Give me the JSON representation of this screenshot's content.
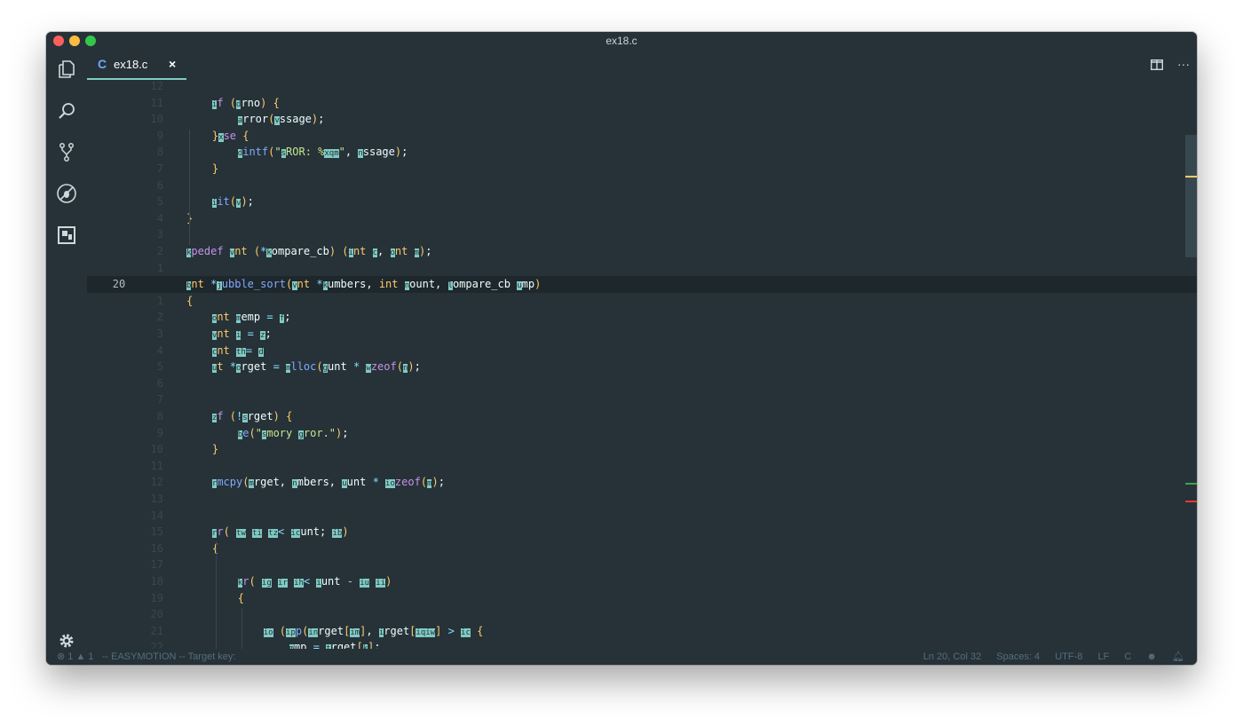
{
  "window": {
    "title": "ex18.c"
  },
  "tab": {
    "lang_icon": "C",
    "name": "ex18.c",
    "close": "×"
  },
  "tab_actions": {
    "split": "split-editor-icon",
    "more": "···"
  },
  "activity": [
    "files-icon",
    "search-icon",
    "source-control-icon",
    "debug-icon",
    "extensions-icon"
  ],
  "settings_icon": "gear-icon",
  "editor": {
    "current_line": 20,
    "lines": [
      {
        "n": "12",
        "html": ""
      },
      {
        "n": "11",
        "html": "    <span class='ej'>i</span><span class='tok-kw'>f</span> <span class='tok-br'>(</span><span class='ej'>d</span>rno<span class='tok-br'>)</span> <span class='tok-br'>{</span>"
      },
      {
        "n": "10",
        "html": "        <span class='ej'>a</span>rror<span class='tok-br'>(</span><span class='ej'>v</span>ssage<span class='tok-br'>)</span>;"
      },
      {
        "n": "9",
        "html": "    <span class='tok-br'>}</span><span class='ej'>x</span><span class='tok-kw'>se</span> <span class='tok-br'>{</span>"
      },
      {
        "n": "8",
        "html": "        <span class='ej'>d</span><span class='tok-fn'>intf</span><span class='tok-br'>(</span><span class='tok-str'>\"</span><span class='ej'>s</span><span class='tok-str'>ROR: %</span><span class='ej'>xq</span><span class='ej'>m</span><span class='tok-str'>\"</span>, <span class='ej'>n</span>ssage<span class='tok-br'>)</span>;"
      },
      {
        "n": "7",
        "html": "    <span class='tok-br'>}</span>"
      },
      {
        "n": "6",
        "html": ""
      },
      {
        "n": "5",
        "html": "    <span class='ej'>i</span><span class='tok-fn'>it</span><span class='tok-br'>(</span><span class='ej'>v</span><span class='tok-br'>)</span>;"
      },
      {
        "n": "4",
        "html": "<span class='tok-br'>}</span>"
      },
      {
        "n": "3",
        "html": ""
      },
      {
        "n": "2",
        "html": "<span class='ej'>k</span><span class='tok-kw'>pedef</span> <span class='ej'>v</span><span class='tok-ty'>nt</span> <span class='tok-br'>(</span><span class='tok-op'>*</span><span class='ej'>k</span>ompare_cb<span class='tok-br'>)</span> <span class='tok-br'>(</span><span class='ej'>i</span><span class='tok-ty'>nt</span> <span class='ej'>c</span>, <span class='ej'>o</span><span class='tok-ty'>nt</span> <span class='ej'>m</span><span class='tok-br'>)</span>;"
      },
      {
        "n": "1",
        "html": ""
      },
      {
        "n": "20",
        "html": "<span class='ej'>b</span><span class='tok-ty'>nt</span> <span class='tok-op'>*</span><span class='ej'>j</span><span class='tok-fn'>ubble_sort</span><span class='tok-br'>(</span><span class='ej'>v</span><span class='tok-ty'>nt</span> <span class='tok-op'>*</span><span class='ej'>k</span>umbers, <span class='tok-ty'>int</span> <span class='ej'>n</span>ount, <span class='ej'>l</span>ompare_cb <span class='ej'>u</span>mp<span class='tok-br'>)</span>"
      },
      {
        "n": "1",
        "html": "<span class='tok-br'>{</span>"
      },
      {
        "n": "2",
        "html": "    <span class='ej'>o</span><span class='tok-ty'>nt</span> <span class='ej'>m</span>emp <span class='tok-op'>=</span> <span class='ej'>f</span>;"
      },
      {
        "n": "3",
        "html": "    <span class='ej'>v</span><span class='tok-ty'>nt</span> <span class='ej'>i</span> <span class='tok-op'>=</span> <span class='ej'>z</span>;"
      },
      {
        "n": "4",
        "html": "    <span class='ej'>c</span><span class='tok-ty'>nt</span> <span class='ej'>th</span><span class='tok-op'>=</span> <span class='ej'>d</span>"
      },
      {
        "n": "5",
        "html": "    <span class='ej'>u</span><span class='tok-ty'>t</span> <span class='tok-op'>*</span><span class='ej'>o</span>rget <span class='tok-op'>=</span> <span class='ej'>m</span><span class='tok-fn'>lloc</span><span class='tok-br'>(</span><span class='ej'>g</span>unt <span class='tok-op'>*</span> <span class='ej'>w</span><span class='tok-kw'>zeof</span><span class='tok-br'>(</span><span class='ej'>n</span><span class='tok-br'>)</span>;"
      },
      {
        "n": "6",
        "html": ""
      },
      {
        "n": "7",
        "html": ""
      },
      {
        "n": "8",
        "html": "    <span class='ej'>z</span><span class='tok-kw'>f</span> <span class='tok-br'>(</span><span class='tok-op'>!</span><span class='ej'>s</span>rget<span class='tok-br'>)</span> <span class='tok-br'>{</span>"
      },
      {
        "n": "9",
        "html": "        <span class='ej'>b</span><span class='tok-fn'>e</span><span class='tok-br'>(</span><span class='tok-str'>\"</span><span class='ej'>s</span><span class='tok-str'>mory </span><span class='ej'>g</span><span class='tok-str'>ror.\"</span><span class='tok-br'>)</span>;"
      },
      {
        "n": "10",
        "html": "    <span class='tok-br'>}</span>"
      },
      {
        "n": "11",
        "html": ""
      },
      {
        "n": "12",
        "html": "    <span class='ej'>r</span><span class='tok-fn'>mcpy</span><span class='tok-br'>(</span><span class='ej'>m</span>rget, <span class='ej'>n</span>mbers, <span class='ej'>u</span>unt <span class='tok-op'>*</span> <span class='ej'>io</span><span class='tok-kw'>zeof</span><span class='tok-br'>(</span><span class='ej'>m</span><span class='tok-br'>)</span>;"
      },
      {
        "n": "13",
        "html": ""
      },
      {
        "n": "14",
        "html": ""
      },
      {
        "n": "15",
        "html": "    <span class='ej'>r</span><span class='tok-kw'>r</span><span class='tok-br'>(</span> <span class='ej'>tw</span> <span class='ej'>ti</span> <span class='ej'>tz</span><span class='tok-op'>&lt;</span> <span class='ej'>ic</span>unt; <span class='ej'>ib</span><span class='tok-br'>)</span>"
      },
      {
        "n": "16",
        "html": "    <span class='tok-br'>{</span>"
      },
      {
        "n": "17",
        "html": ""
      },
      {
        "n": "18",
        "html": "        <span class='ej'>k</span><span class='tok-kw'>r</span><span class='tok-br'>(</span> <span class='ej'>ig</span> <span class='ej'>ir</span> <span class='ej'>ih</span><span class='tok-op'>&lt;</span> <span class='ej'>i</span>unt <span class='tok-op'>-</span> <span class='ej'>iu</span> <span class='ej'>ii</span><span class='tok-br'>)</span>"
      },
      {
        "n": "19",
        "html": "        <span class='tok-br'>{</span>"
      },
      {
        "n": "20",
        "html": ""
      },
      {
        "n": "21",
        "html": "            <span class='ej'>io</span> <span class='tok-br'>(</span><span class='ej'>ip</span><span class='tok-fn'>p</span><span class='tok-br'>(</span><span class='ej'>in</span>rget<span class='tok-br'>[</span><span class='ej'>im</span><span class='tok-br'>]</span>, <span class='ej'>i</span>rget<span class='tok-br'>[</span><span class='ej'>iq</span><span class='ej'>iw</span><span class='tok-br'>]</span> <span class='tok-op'>&gt;</span> <span class='ej'>ic</span> <span class='tok-br'>{</span>"
      },
      {
        "n": "22",
        "html": "                <span class='ej'>m</span>mp <span class='tok-op'>=</span> <span class='ej'>t</span>rget<span class='tok-br'>[</span><span class='ej'>k</span><span class='tok-br'>]</span>;"
      }
    ]
  },
  "status": {
    "errors": "1",
    "warnings": "1",
    "mode": "-- EASYMOTION -- Target key:",
    "position": "Ln 20, Col 32",
    "spaces": "Spaces: 4",
    "encoding": "UTF-8",
    "eol": "LF",
    "language": "C"
  },
  "colors": {
    "accent": "#80cbc4",
    "background": "#263238"
  }
}
